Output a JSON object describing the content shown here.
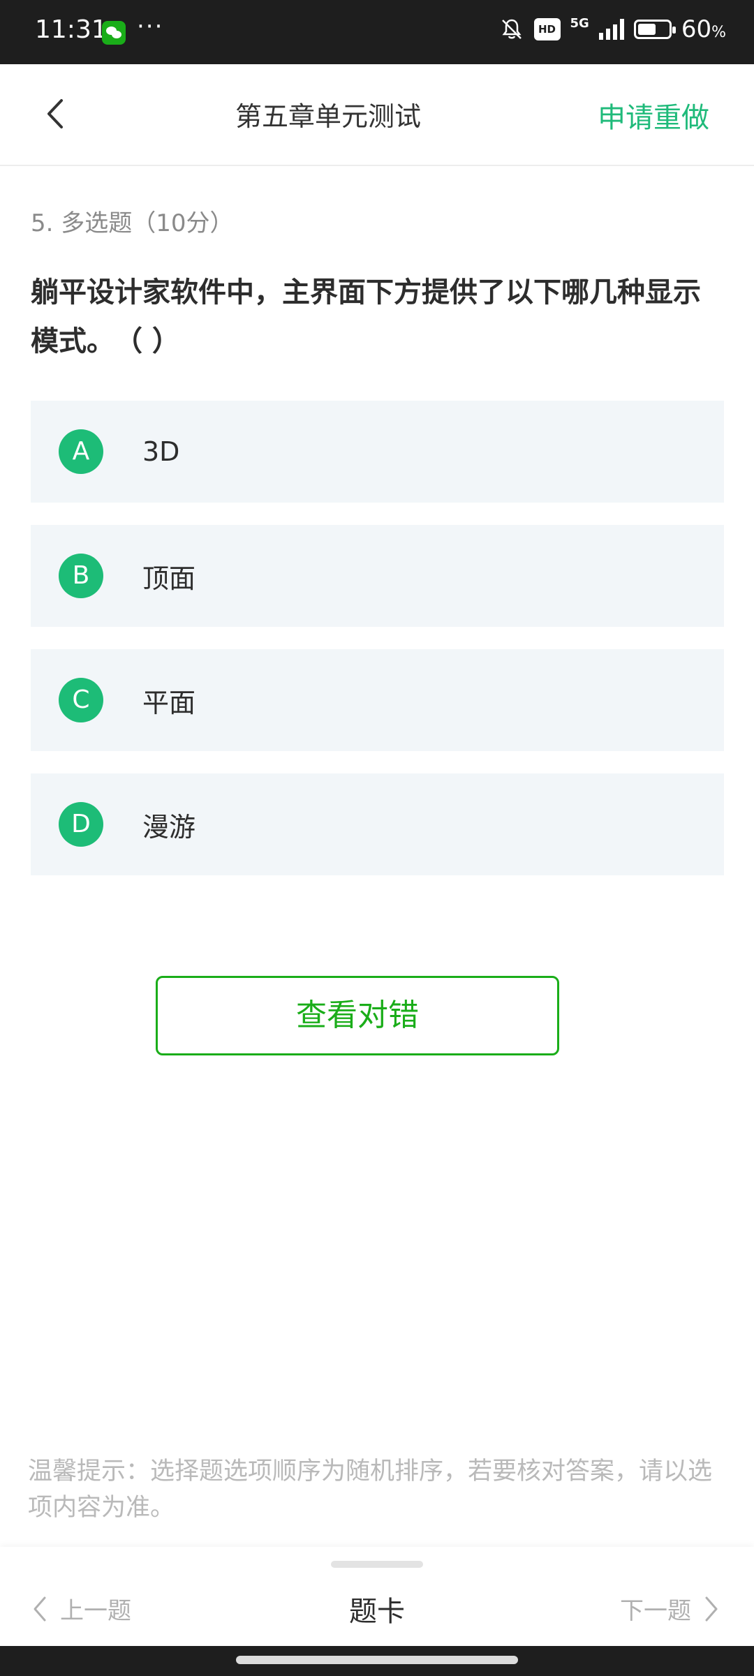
{
  "status_bar": {
    "time": "11:31",
    "dots": "···",
    "network": "5G",
    "hd": "HD",
    "battery_percent": "60",
    "battery_unit": "%",
    "battery_level": 0.6
  },
  "header": {
    "title": "第五章单元测试",
    "redo_label": "申请重做",
    "accent_color": "#1fba7a"
  },
  "question": {
    "meta": "5. 多选题（10分）",
    "text": "躺平设计家软件中，主界面下方提供了以下哪几种显示模式。　（ ）"
  },
  "options": [
    {
      "letter": "A",
      "text": "3D"
    },
    {
      "letter": "B",
      "text": "顶面"
    },
    {
      "letter": "C",
      "text": "平面"
    },
    {
      "letter": "D",
      "text": "漫游"
    }
  ],
  "check_button": "查看对错",
  "tip": "温馨提示：选择题选项顺序为随机排序，若要核对答案，请以选项内容为准。",
  "bottom_nav": {
    "prev": "上一题",
    "card": "题卡",
    "next": "下一题"
  },
  "icons": {
    "back": "chevron-left-icon",
    "mute": "bell-off-icon",
    "wechat": "wechat-icon"
  }
}
